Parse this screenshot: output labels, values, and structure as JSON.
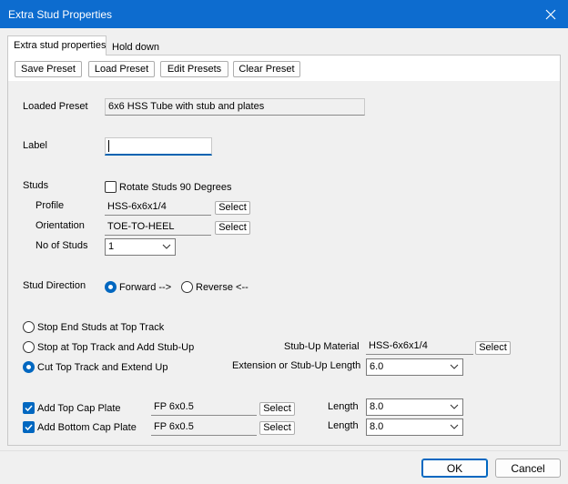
{
  "window": {
    "title": "Extra Stud Properties"
  },
  "tabs": [
    {
      "label": "Extra stud properties",
      "active": true
    },
    {
      "label": "Hold down",
      "active": false
    }
  ],
  "toolbar": {
    "save_preset": "Save Preset",
    "load_preset": "Load Preset",
    "edit_presets": "Edit Presets",
    "clear_preset": "Clear Preset"
  },
  "loaded_preset": {
    "label": "Loaded Preset",
    "value": "6x6 HSS Tube with stub and plates"
  },
  "label_field": {
    "label": "Label",
    "value": ""
  },
  "studs": {
    "label": "Studs",
    "rotate": {
      "label": "Rotate Studs 90 Degrees",
      "checked": false
    },
    "profile": {
      "label": "Profile",
      "value": "HSS-6x6x1/4",
      "button": "Select"
    },
    "orientation": {
      "label": "Orientation",
      "value": "TOE-TO-HEEL",
      "button": "Select"
    },
    "count": {
      "label": "No of Studs",
      "value": "1"
    }
  },
  "stud_direction": {
    "label": "Stud Direction",
    "forward": {
      "label": "Forward -->",
      "selected": true
    },
    "reverse": {
      "label": "Reverse <--",
      "selected": false
    }
  },
  "top_track": {
    "stop_end": {
      "label": "Stop End Studs at Top Track",
      "selected": false
    },
    "stop_stub": {
      "label": "Stop at Top Track and Add Stub-Up",
      "selected": false
    },
    "cut_extend": {
      "label": "Cut Top Track and Extend Up",
      "selected": true
    }
  },
  "stub_up": {
    "material_label": "Stub-Up Material",
    "material_value": "HSS-6x6x1/4",
    "material_button": "Select",
    "length_label": "Extension or Stub-Up Length",
    "length_value": "6.0"
  },
  "top_cap": {
    "label": "Add Top Cap Plate",
    "checked": true,
    "value": "FP 6x0.5",
    "button": "Select",
    "length_label": "Length",
    "length_value": "8.0"
  },
  "bottom_cap": {
    "label": "Add Bottom Cap Plate",
    "checked": true,
    "value": "FP 6x0.5",
    "button": "Select",
    "length_label": "Length",
    "length_value": "8.0"
  },
  "footer": {
    "ok": "OK",
    "cancel": "Cancel"
  },
  "colors": {
    "titlebar": "#0d6ccf",
    "accent": "#0067c0"
  }
}
